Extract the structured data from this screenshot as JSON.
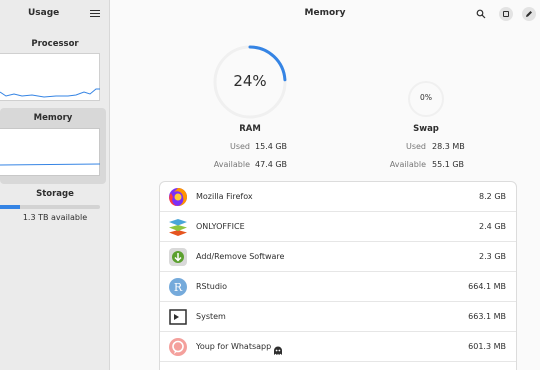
{
  "sidebar": {
    "title": "Usage",
    "items": [
      {
        "label": "Processor"
      },
      {
        "label": "Memory"
      },
      {
        "label": "Storage",
        "detail": "1.3 TB available",
        "fill": 0.2
      }
    ]
  },
  "header": {
    "title": "Memory"
  },
  "ram": {
    "title": "RAM",
    "percent_label": "24%",
    "percent": 24,
    "used_label": "Used",
    "used": "15.4 GB",
    "available_label": "Available",
    "available": "47.4 GB"
  },
  "swap": {
    "title": "Swap",
    "percent_label": "0%",
    "percent": 0,
    "used_label": "Used",
    "used": "28.3 MB",
    "available_label": "Available",
    "available": "55.1 GB"
  },
  "apps": [
    {
      "name": "Mozilla Firefox",
      "size": "8.2 GB",
      "icon": "firefox-icon"
    },
    {
      "name": "ONLYOFFICE",
      "size": "2.4 GB",
      "icon": "onlyoffice-icon"
    },
    {
      "name": "Add/Remove Software",
      "size": "2.3 GB",
      "icon": "software-icon"
    },
    {
      "name": "RStudio",
      "size": "664.1 MB",
      "icon": "rstudio-icon"
    },
    {
      "name": "System",
      "size": "663.1 MB",
      "icon": "system-icon"
    },
    {
      "name": "Youp for Whatsapp",
      "size": "601.3 MB",
      "icon": "youp-icon"
    }
  ],
  "colors": {
    "accent": "#3584e4"
  }
}
